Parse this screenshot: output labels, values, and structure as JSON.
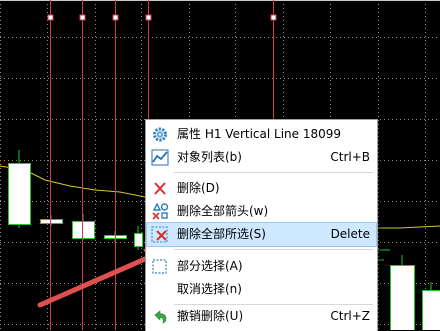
{
  "colors": {
    "background": "#000000",
    "grid": "#8a8a8a",
    "vertical_line": "#d63a48",
    "candle": "#2ac32a",
    "moving_average": "#d4cc2c",
    "arrow": "#e05050",
    "menu_highlight": "#cde8ff"
  },
  "context_menu": {
    "items": [
      {
        "label": "属性 H1 Vertical Line 18099",
        "shortcut": "",
        "icon": "properties-gear-icon"
      },
      {
        "label": "对象列表(b)",
        "shortcut": "Ctrl+B",
        "icon": "object-list-icon"
      },
      {
        "label": "删除(D)",
        "shortcut": "",
        "icon": "delete-x-icon"
      },
      {
        "label": "删除全部箭头(w)",
        "shortcut": "",
        "icon": "delete-arrows-icon"
      },
      {
        "label": "删除全部所选(S)",
        "shortcut": "Delete",
        "icon": "delete-selected-icon",
        "highlighted": true
      },
      {
        "label": "部分选择(A)",
        "shortcut": "",
        "icon": "partial-select-icon"
      },
      {
        "label": "取消选择(n)",
        "shortcut": "",
        "icon": ""
      },
      {
        "label": "撤销删除(U)",
        "shortcut": "Ctrl+Z",
        "icon": "undo-delete-icon"
      }
    ]
  }
}
